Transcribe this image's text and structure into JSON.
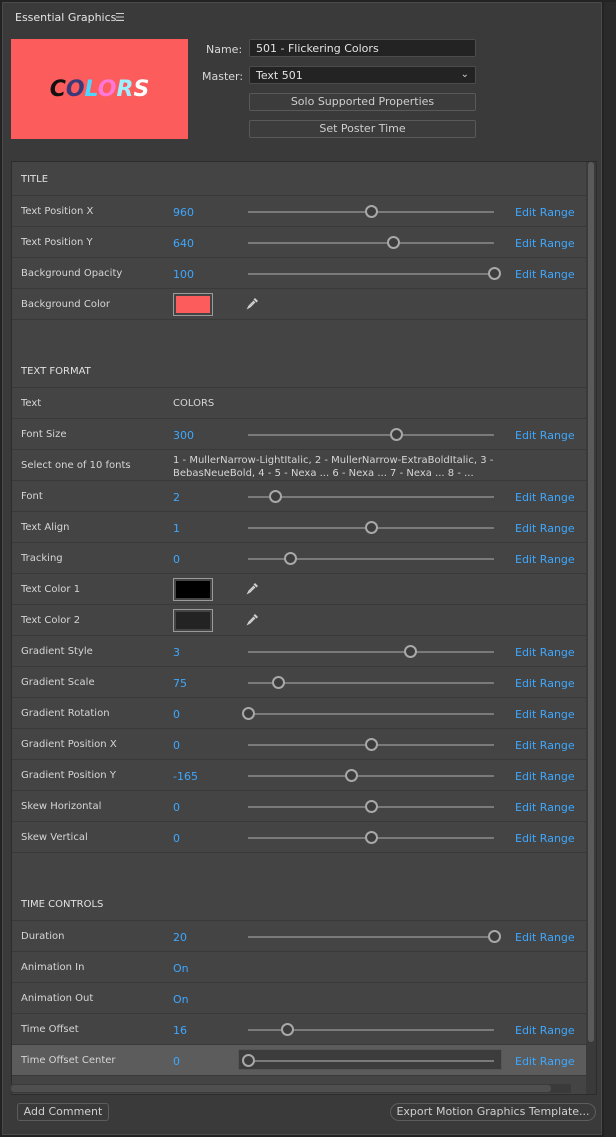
{
  "panel": {
    "title": "Essential Graphics",
    "menu_icon": "hamburger-menu-icon"
  },
  "poster": {
    "text_chars": [
      "C",
      "O",
      "L",
      "O",
      "R",
      "S"
    ],
    "background_color": "#fc5c5c"
  },
  "meta": {
    "name_label": "Name:",
    "name_value": "501 - Flickering Colors",
    "master_label": "Master:",
    "master_value": "Text 501",
    "solo_button": "Solo Supported Properties",
    "poster_button": "Set Poster Time"
  },
  "edit_range_label": "Edit Range",
  "rows": [
    {
      "kind": "section",
      "label": "TITLE"
    },
    {
      "kind": "slider",
      "label": "Text Position X",
      "value": "960",
      "slider_fraction": 0.5
    },
    {
      "kind": "slider",
      "label": "Text Position Y",
      "value": "640",
      "slider_fraction": 0.59
    },
    {
      "kind": "slider",
      "label": "Background Opacity",
      "value": "100",
      "slider_fraction": 1.0
    },
    {
      "kind": "color",
      "label": "Background Color",
      "color": "#fc5c5c",
      "icon": "eyedropper-icon"
    },
    {
      "kind": "blank"
    },
    {
      "kind": "section",
      "label": "TEXT FORMAT"
    },
    {
      "kind": "text",
      "label": "Text",
      "text": "COLORS"
    },
    {
      "kind": "slider",
      "label": "Font Size",
      "value": "300",
      "slider_fraction": 0.6
    },
    {
      "kind": "longtext",
      "label": "Select one of 10 fonts",
      "text": "1 - MullerNarrow-LightItalic, 2 - MullerNarrow-ExtraBoldItalic, 3 - BebasNeueBold, 4 - 5 - Nexa ... 6 - Nexa ... 7 - Nexa ... 8 - ..."
    },
    {
      "kind": "slider",
      "label": "Font",
      "value": "2",
      "slider_fraction": 0.11
    },
    {
      "kind": "slider",
      "label": "Text Align",
      "value": "1",
      "slider_fraction": 0.5
    },
    {
      "kind": "slider",
      "label": "Tracking",
      "value": "0",
      "slider_fraction": 0.17
    },
    {
      "kind": "color",
      "label": "Text Color 1",
      "color": "#000000",
      "icon": "eyedropper-icon"
    },
    {
      "kind": "color",
      "label": "Text Color 2",
      "color": "#232323",
      "icon": "eyedropper-icon"
    },
    {
      "kind": "slider",
      "label": "Gradient Style",
      "value": "3",
      "slider_fraction": 0.66
    },
    {
      "kind": "slider",
      "label": "Gradient Scale",
      "value": "75",
      "slider_fraction": 0.12
    },
    {
      "kind": "slider",
      "label": "Gradient Rotation",
      "value": "0",
      "slider_fraction": 0.0
    },
    {
      "kind": "slider",
      "label": "Gradient Position X",
      "value": "0",
      "slider_fraction": 0.5
    },
    {
      "kind": "slider",
      "label": "Gradient Position Y",
      "value": "-165",
      "slider_fraction": 0.42
    },
    {
      "kind": "slider",
      "label": "Skew Horizontal",
      "value": "0",
      "slider_fraction": 0.5
    },
    {
      "kind": "slider",
      "label": "Skew Vertical",
      "value": "0",
      "slider_fraction": 0.5
    },
    {
      "kind": "blank"
    },
    {
      "kind": "section",
      "label": "TIME CONTROLS"
    },
    {
      "kind": "slider",
      "label": "Duration",
      "value": "20",
      "slider_fraction": 1.0
    },
    {
      "kind": "checkbox",
      "label": "Animation In",
      "value": "On"
    },
    {
      "kind": "checkbox",
      "label": "Animation Out",
      "value": "On"
    },
    {
      "kind": "slider",
      "label": "Time Offset",
      "value": "16",
      "slider_fraction": 0.16
    },
    {
      "kind": "slider",
      "label": "Time Offset Center",
      "value": "0",
      "slider_fraction": 0.0,
      "highlighted": true
    }
  ],
  "footer": {
    "add_comment": "Add Comment",
    "export": "Export Motion Graphics Template..."
  }
}
